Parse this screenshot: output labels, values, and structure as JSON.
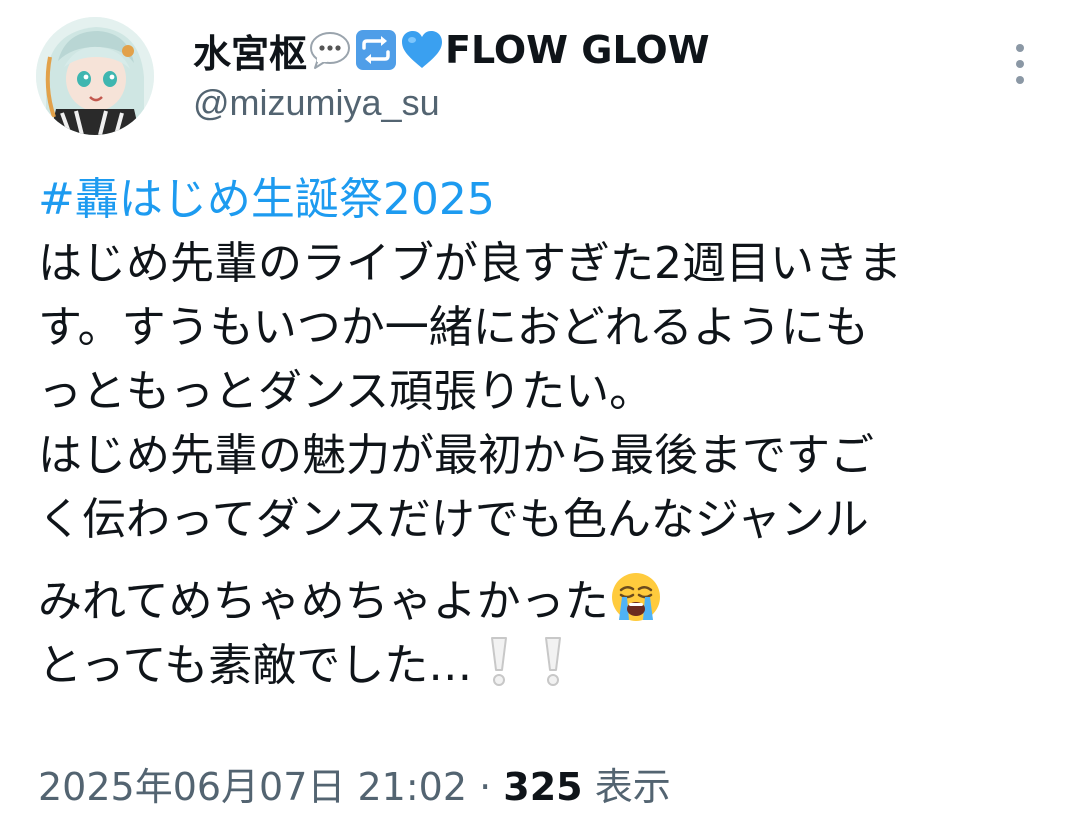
{
  "author": {
    "display_name_prefix": "水宮枢",
    "display_name_suffix": "FLOW GLOW",
    "name_icons": [
      "speech-bubble-icon",
      "repeat-arrows-icon",
      "blue-heart-icon"
    ],
    "handle": "@mizumiya_su"
  },
  "tweet": {
    "hashtag": "#轟はじめ生誕祭2025",
    "lines": [
      "はじめ先輩のライブが良すぎた2週目いきま",
      "す。すうもいつか一緒におどれるようにも",
      "っともっとダンス頑張りたい。",
      "はじめ先輩の魅力が最初から最後まですご",
      "く伝わってダンスだけでも色んなジャンル",
      "みれてめちゃめちゃよかった",
      "とっても素敵でした…"
    ],
    "line_emojis": {
      "crying": "loudly-crying-face-icon",
      "exclamations": "white-exclamation-mark-icon"
    }
  },
  "meta": {
    "datetime": "2025年06月07日 21:02",
    "separator": "·",
    "views_count": "325",
    "views_label": "表示"
  },
  "colors": {
    "link": "#1d9bf0",
    "secondary_text": "#536471",
    "primary_text": "#0f1419",
    "heart_blue": "#3aa0f0",
    "repeat_blue": "#4f9ee8"
  }
}
